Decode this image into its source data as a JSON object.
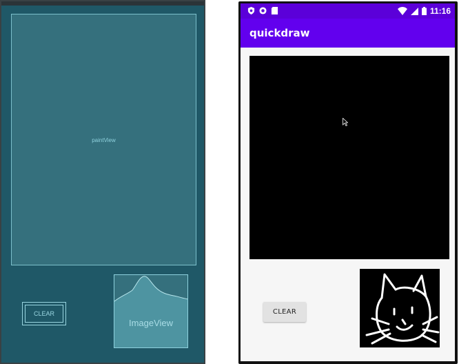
{
  "blueprint": {
    "paint_view_label": "paintView",
    "clear_label": "CLEAR",
    "image_view_label": "ImageView"
  },
  "device": {
    "status_bar": {
      "time": "11:16",
      "icons": [
        "shield-icon",
        "record-icon",
        "sd-card-icon",
        "wifi-icon",
        "signal-icon",
        "battery-icon"
      ]
    },
    "app_bar": {
      "title": "quickdraw"
    },
    "clear_button_label": "CLEAR",
    "colors": {
      "status_bar": "#5b00d9",
      "app_bar": "#6200ee",
      "paint_view": "#000000",
      "blueprint_bg": "#1f5867"
    }
  }
}
